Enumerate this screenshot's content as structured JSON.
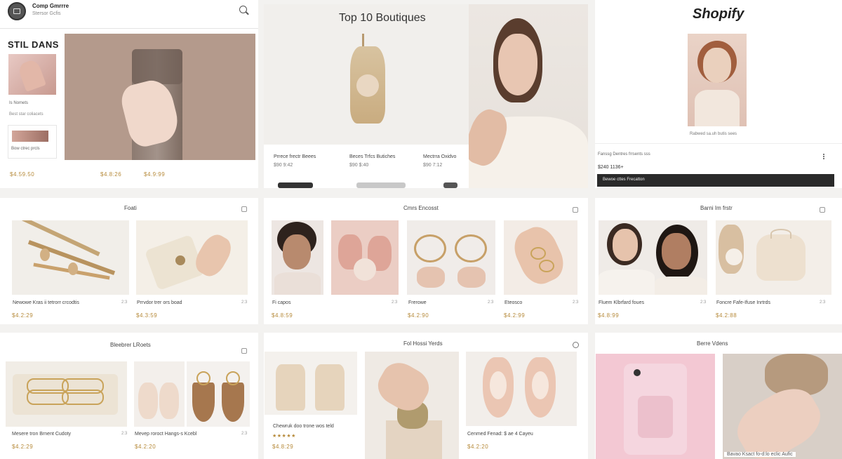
{
  "top_left": {
    "store_name": "Comp Gmrrre",
    "store_sub": "Stersor Gcfis",
    "section_title": "STIL DANS",
    "sidebar_label1": "Is Nomets",
    "sidebar_label2": "Best star coliacets",
    "sidebar_label3": "Bow ctrec prcls",
    "price1": "$4.59.50",
    "price2": "$4.8:26",
    "price3": "$4.9:99"
  },
  "top_middle": {
    "title": "Top 10 Boutiques",
    "item1_name": "Prrece frectr Beees",
    "item1_price": "$90 9:42",
    "item2_name": "Beces Trfcs Butiches",
    "item2_price": "$90 $:40",
    "item3_name": "Mectrra Oxidvo",
    "item3_price": "$90 7:12"
  },
  "top_right": {
    "brand": "Shopify",
    "caption": "Rabwed sa.uh butis sees",
    "detail": "Fanssg Dentres frrsents sss",
    "price": "$240 1136+",
    "button_label": "Bewoe cttes Frecatton"
  },
  "row2_left": {
    "title": "Foati",
    "item1_name": "Newowe Kras ii tetrorr crcodtis",
    "item1_count": "2:3",
    "item1_price": "$4.2:29",
    "item2_name": "Prrvdor trer ors boad",
    "item2_count": "2:3",
    "item2_price": "$4.3:59"
  },
  "row2_middle": {
    "title": "Cmrs Encosst",
    "item1_name": "Fi capos",
    "item1_count": "2:3",
    "item1_price": "$4.8:59",
    "item2_name": "Frerowe",
    "item2_count": "2:3",
    "item2_price": "$4.2:90",
    "item3_name": "Eteosco",
    "item3_count": "2:3",
    "item3_price": "$4.2:99"
  },
  "row2_right": {
    "title": "Barni Im frstr",
    "item1_name": "Fluem Klbrfard foues",
    "item1_count": "2:3",
    "item1_price": "$4.8:99",
    "item2_name": "Foncre Fafe-Ifuse Inrtrds",
    "item2_count": "2:3",
    "item2_price": "$4.2:88"
  },
  "row3_left": {
    "title": "Bleebrer LRoets",
    "item1_name": "Mesere tron Brnent Cudoty",
    "item1_count": "2:3",
    "item1_price": "$4.2:29",
    "item2_name": "Mevep roroct Hangs-s Kcebl",
    "item2_count": "2:3",
    "item2_price": "$4.2:20"
  },
  "row3_middle": {
    "title": "Fol Hossi Yerds",
    "item1_name": "Chewruk doo trone wos teld",
    "item1_price": "$4.8:29",
    "item2_name": "Cenmed Fenad: $ ae 4 Cayeu",
    "item2_price": "$4.2:20"
  },
  "row3_right": {
    "title": "Berre Vdens",
    "caption": "Bavao Ksact fo-d:lo eclic Aufic"
  },
  "colors": {
    "accent_gold": "#b68a3a",
    "dark_button": "#2a2a2a",
    "panel_bg": "#ffffff"
  }
}
